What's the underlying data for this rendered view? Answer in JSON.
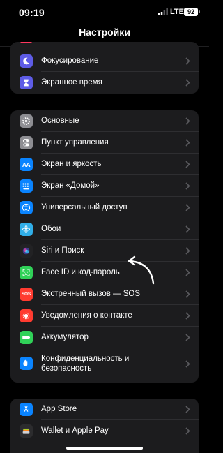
{
  "status_bar": {
    "time": "09:19",
    "network": "LTE",
    "battery": "92"
  },
  "nav": {
    "title": "Настройки"
  },
  "groups": [
    {
      "items": [
        {
          "label": "Фокусирование",
          "icon": "moon-icon",
          "color": "#5e5ce6"
        },
        {
          "label": "Экранное время",
          "icon": "hourglass-icon",
          "color": "#5e5ce6"
        }
      ]
    },
    {
      "items": [
        {
          "label": "Основные",
          "icon": "gear-icon",
          "color": "#8e8e93"
        },
        {
          "label": "Пункт управления",
          "icon": "toggles-icon",
          "color": "#8e8e93"
        },
        {
          "label": "Экран и яркость",
          "icon": "text-size-icon",
          "color": "#0a84ff"
        },
        {
          "label": "Экран «Домой»",
          "icon": "home-grid-icon",
          "color": "#0a84ff"
        },
        {
          "label": "Универсальный доступ",
          "icon": "accessibility-icon",
          "color": "#0a84ff"
        },
        {
          "label": "Обои",
          "icon": "flower-icon",
          "color": "#30aee8"
        },
        {
          "label": "Siri и Поиск",
          "icon": "siri-icon",
          "color": "#222224"
        },
        {
          "label": "Face ID и код-пароль",
          "icon": "face-id-icon",
          "color": "#30d158"
        },
        {
          "label": "Экстренный вызов — SOS",
          "icon": "sos-icon",
          "color": "#ff3b30"
        },
        {
          "label": "Уведомления о контакте",
          "icon": "exposure-icon",
          "color": "#ff3b30"
        },
        {
          "label": "Аккумулятор",
          "icon": "battery-icon",
          "color": "#30d158"
        },
        {
          "label": "Конфиденциальность и безопасность",
          "icon": "hand-icon",
          "color": "#0a84ff"
        }
      ]
    },
    {
      "items": [
        {
          "label": "App Store",
          "icon": "app-store-icon",
          "color": "#0a84ff"
        },
        {
          "label": "Wallet и Apple Pay",
          "icon": "wallet-icon",
          "color": "#2c2c2e"
        }
      ]
    }
  ],
  "sos_text": "SOS",
  "text_size_glyph": "AA"
}
